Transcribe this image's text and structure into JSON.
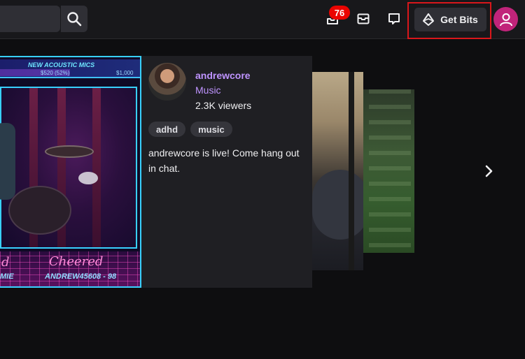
{
  "topbar": {
    "search_placeholder": "",
    "notification_count": "76",
    "get_bits_label": "Get Bits"
  },
  "featured": {
    "channel_name": "andrewcore",
    "category": "Music",
    "viewers": "2.3K viewers",
    "tags": [
      "adhd",
      "music"
    ],
    "description": "andrewcore is live! Come hang out in chat.",
    "overlay": {
      "goal_title": "NEW ACOUSTIC MICS",
      "goal_amount": "$520 (52%)",
      "goal_max": "$1,000",
      "left_label": "d",
      "cheered_label": "Cheered",
      "left_name": "MIE",
      "cheer_name": "ANDREW45608 - 98"
    }
  },
  "colors": {
    "accent": "#bf94ff",
    "badge": "#eb0400",
    "highlight_box": "#d9171b",
    "avatar": "#c1247a"
  }
}
